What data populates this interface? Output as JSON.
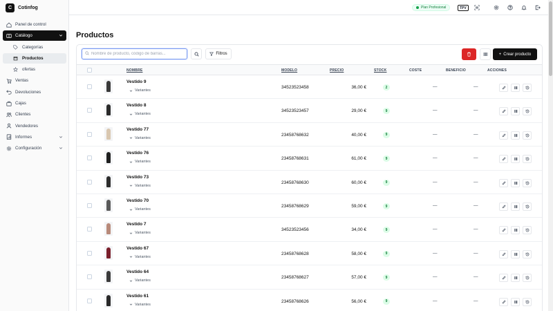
{
  "app": {
    "name": "Cotinfog",
    "logo_letter": "C"
  },
  "sidebar": {
    "items": [
      {
        "label": "Panel de control",
        "icon": "dashboard-icon"
      },
      {
        "label": "Catálogo",
        "icon": "book-icon",
        "active": true,
        "expanded": true
      },
      {
        "label": "Categorías",
        "icon": "tag-icon",
        "sub": true
      },
      {
        "label": "Productos",
        "icon": "box-icon",
        "sub": true,
        "selected": true
      },
      {
        "label": "ofertas",
        "icon": "star-icon",
        "sub": true
      },
      {
        "label": "Ventas",
        "icon": "cart-icon"
      },
      {
        "label": "Devoluciones",
        "icon": "return-icon"
      },
      {
        "label": "Cajas",
        "icon": "register-icon"
      },
      {
        "label": "Clientes",
        "icon": "users-icon"
      },
      {
        "label": "Vendedores",
        "icon": "user-icon"
      },
      {
        "label": "Informes",
        "icon": "chart-icon",
        "has_children": true
      },
      {
        "label": "Configuración",
        "icon": "gear-icon",
        "has_children": true
      }
    ]
  },
  "topbar": {
    "plan": "Plan Profesional",
    "tpv": "TPV",
    "icons": [
      "barcode-scan-icon",
      "settings-icon",
      "help-icon",
      "bell-icon",
      "logout-icon"
    ]
  },
  "page": {
    "title": "Productos"
  },
  "toolbar": {
    "search_placeholder": "Nombre de producto, código de barras...",
    "filter_label": "Filtros",
    "create_label": "Crear producto"
  },
  "table": {
    "headers": {
      "name": "NOMBRE",
      "model": "MODELO",
      "price": "PRECIO",
      "stock": "STOCK",
      "cost": "COSTE",
      "benefit": "BENEFICIO",
      "actions": "ACCIONES"
    },
    "variants_label": "Variantes",
    "rows": [
      {
        "name": "Vestido 9",
        "model": "34523523458",
        "price": "36,00 €",
        "stock": "2",
        "cost": "—",
        "benefit": "—"
      },
      {
        "name": "Vestido 8",
        "model": "34523523457",
        "price": "29,00 €",
        "stock": "9",
        "cost": "—",
        "benefit": "—"
      },
      {
        "name": "Vestido 77",
        "model": "23458768632",
        "price": "40,00 €",
        "stock": "9",
        "cost": "—",
        "benefit": "—"
      },
      {
        "name": "Vestido 76",
        "model": "23458768631",
        "price": "61,00 €",
        "stock": "9",
        "cost": "—",
        "benefit": "—"
      },
      {
        "name": "Vestido 73",
        "model": "23458768630",
        "price": "60,00 €",
        "stock": "9",
        "cost": "—",
        "benefit": "—"
      },
      {
        "name": "Vestido 70",
        "model": "23458768629",
        "price": "59,00 €",
        "stock": "9",
        "cost": "—",
        "benefit": "—"
      },
      {
        "name": "Vestido 7",
        "model": "34523523456",
        "price": "34,00 €",
        "stock": "9",
        "cost": "—",
        "benefit": "—"
      },
      {
        "name": "Vestido 67",
        "model": "23458768628",
        "price": "58,00 €",
        "stock": "9",
        "cost": "—",
        "benefit": "—"
      },
      {
        "name": "Vestido 64",
        "model": "23458768627",
        "price": "57,00 €",
        "stock": "9",
        "cost": "—",
        "benefit": "—"
      },
      {
        "name": "Vestido 61",
        "model": "23458768626",
        "price": "56,00 €",
        "stock": "9",
        "cost": "—",
        "benefit": "—"
      }
    ]
  },
  "colors": {
    "brand": "#111111",
    "danger": "#dc2626",
    "stock_badge_bg": "#dcfce7",
    "stock_badge_fg": "#15803d",
    "dress_colors": [
      "#3a3a3a",
      "#2b2b2b",
      "#d9c7b0",
      "#1f1f1f",
      "#2d2d2d",
      "#5a5a5a",
      "#b88a7a",
      "#7a1f2b",
      "#3b3b3b",
      "#2a2a2a"
    ]
  }
}
